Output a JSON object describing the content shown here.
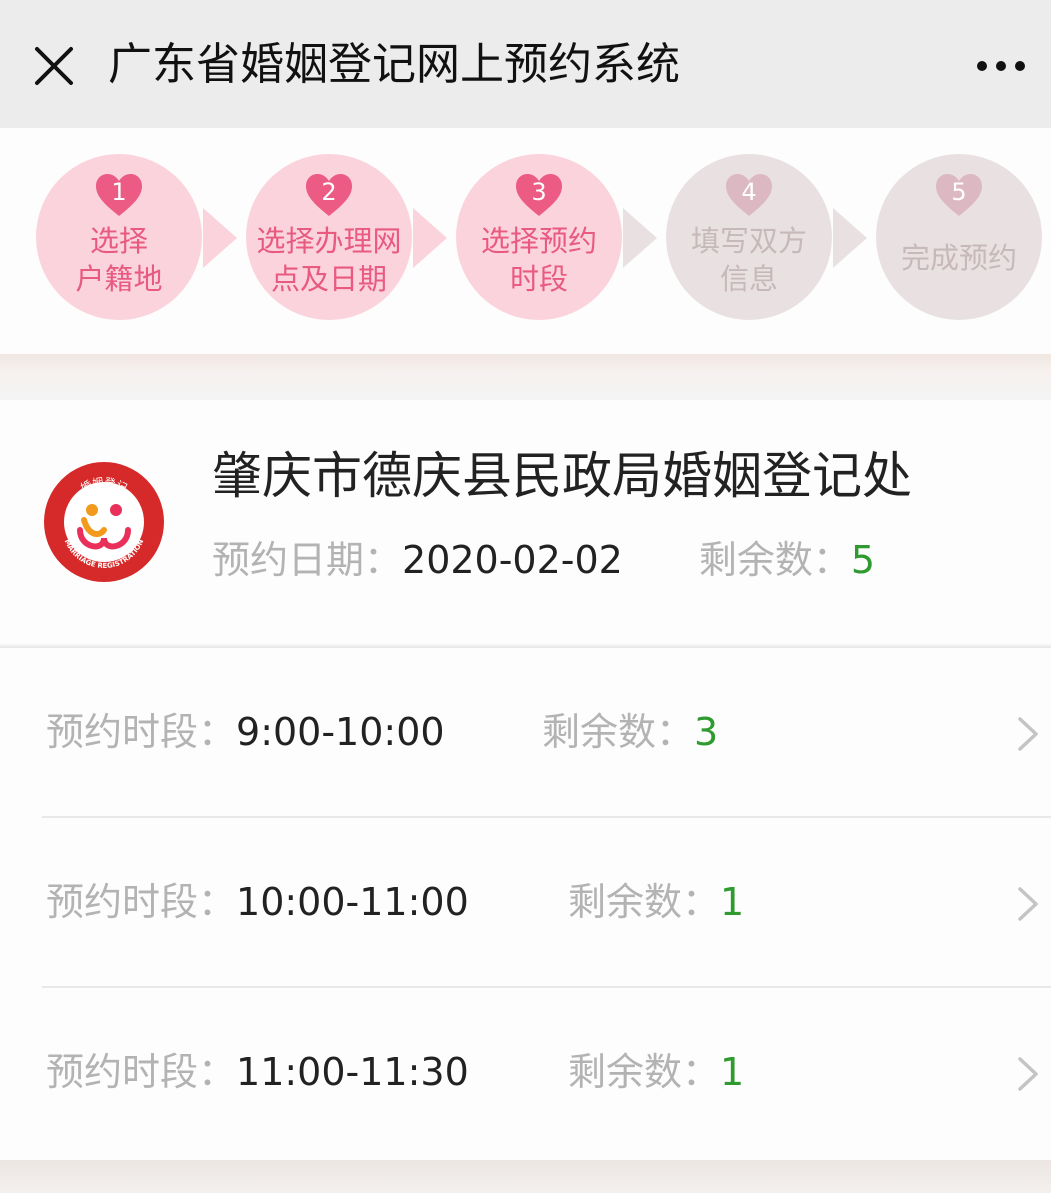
{
  "window": {
    "title": "广东省婚姻登记网上预约系统",
    "close_icon": "close-icon",
    "more_icon": "more-dots-icon"
  },
  "steps": [
    {
      "number": "1",
      "label_line1": "选择",
      "label_line2": "户籍地",
      "status": "completed"
    },
    {
      "number": "2",
      "label_line1": "选择办理网",
      "label_line2": "点及日期",
      "status": "completed"
    },
    {
      "number": "3",
      "label_line1": "选择预约",
      "label_line2": "时段",
      "status": "current"
    },
    {
      "number": "4",
      "label_line1": "填写双方",
      "label_line2": "信息",
      "status": "pending"
    },
    {
      "number": "5",
      "label_line1": "完成预约",
      "label_line2": "",
      "status": "pending"
    }
  ],
  "office": {
    "name": "肇庆市德庆县民政局婚姻登记处",
    "logo_icon": "marriage-registration-logo",
    "logo_text_top": "婚姻登记",
    "logo_text_bottom": "MARRIAGE REGISTRATION",
    "date_label": "预约日期：",
    "date": "2020-02-02",
    "remaining_label": "剩余数：",
    "remaining": "5"
  },
  "slots": [
    {
      "label": "预约时段：",
      "time": "9:00-10:00",
      "remaining_label": "剩余数：",
      "remaining": "3"
    },
    {
      "label": "预约时段：",
      "time": "10:00-11:00",
      "remaining_label": "剩余数：",
      "remaining": "1"
    },
    {
      "label": "预约时段：",
      "time": "11:00-11:30",
      "remaining_label": "剩余数：",
      "remaining": "1"
    }
  ],
  "colors": {
    "step_active_bg": "#fbd3dc",
    "step_active_heart": "#ec5b83",
    "step_active_text": "#e85a7f",
    "step_inactive_bg": "#e9e1e1",
    "step_inactive_heart": "#dcb9c2",
    "remaining_green": "#2f9a2f",
    "chevron_icon": "chevron-right-icon"
  }
}
